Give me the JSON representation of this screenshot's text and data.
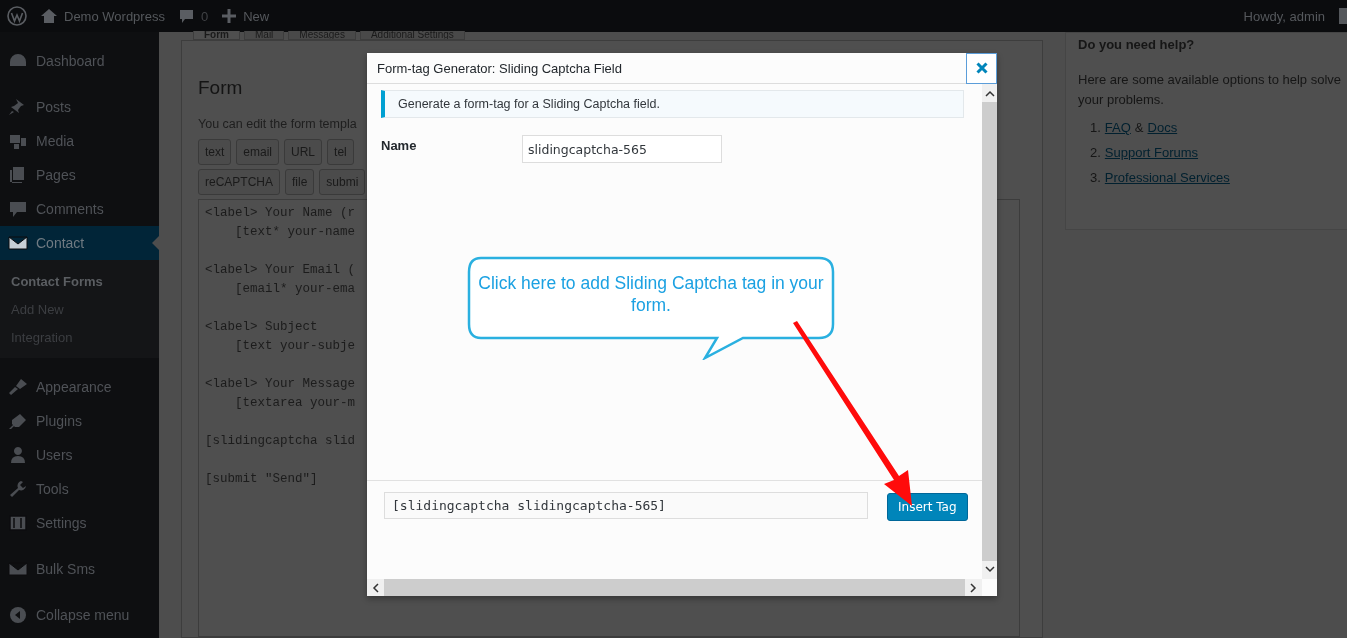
{
  "admin_bar": {
    "site": "Demo Wordpress",
    "comments": "0",
    "new": "New",
    "greeting": "Howdy, admin"
  },
  "sidebar": {
    "items": [
      {
        "label": "Dashboard",
        "selected": false
      },
      {
        "label": "Posts",
        "selected": false
      },
      {
        "label": "Media",
        "selected": false
      },
      {
        "label": "Pages",
        "selected": false
      },
      {
        "label": "Comments",
        "selected": false
      },
      {
        "label": "Contact",
        "selected": true,
        "children": [
          {
            "label": "Contact Forms",
            "selected": true
          },
          {
            "label": "Add New",
            "selected": false
          },
          {
            "label": "Integration",
            "selected": false
          }
        ]
      },
      {
        "label": "Appearance",
        "selected": false
      },
      {
        "label": "Plugins",
        "selected": false
      },
      {
        "label": "Users",
        "selected": false
      },
      {
        "label": "Tools",
        "selected": false
      },
      {
        "label": "Settings",
        "selected": false
      },
      {
        "label": "Bulk Sms",
        "selected": false
      }
    ],
    "collapse": "Collapse menu"
  },
  "tabs": [
    {
      "label": "Form",
      "selected": true
    },
    {
      "label": "Mail",
      "selected": false
    },
    {
      "label": "Messages",
      "selected": false
    },
    {
      "label": "Additional Settings",
      "selected": false
    }
  ],
  "form_panel": {
    "heading": "Form",
    "intro": "You can edit the form templa",
    "tag_buttons": [
      [
        "text",
        "email",
        "URL",
        "tel"
      ],
      [
        "reCAPTCHA",
        "file",
        "submi"
      ]
    ],
    "template_blocks": [
      [
        "<label> Your Name (r",
        "    [text* your-name"
      ],
      [
        "<label> Your Email (",
        "    [email* your-ema"
      ],
      [
        "<label> Subject",
        "    [text your-subje"
      ],
      [
        "<label> Your Message",
        "    [textarea your-m"
      ],
      [
        "[slidingcaptcha slid"
      ],
      [
        "[submit \"Send\"]"
      ]
    ]
  },
  "help": {
    "title": "Do you need help?",
    "text": "Here are some available options to help solve your problems.",
    "separator": "&",
    "items": [
      {
        "number": "1.",
        "links": [
          "FAQ",
          "Docs"
        ]
      },
      {
        "number": "2.",
        "links": [
          "Support Forums"
        ]
      },
      {
        "number": "3.",
        "links": [
          "Professional Services"
        ]
      }
    ]
  },
  "modal": {
    "title": "Form-tag Generator: Sliding Captcha Field",
    "notice": "Generate a form-tag for a Sliding Captcha field.",
    "name_label": "Name",
    "name_value": "slidingcaptcha-565",
    "tag_value": "[slidingcaptcha slidingcaptcha-565]",
    "insert_button": "Insert Tag"
  },
  "callout": {
    "text": "Click here to add Sliding Captcha tag in your form."
  }
}
